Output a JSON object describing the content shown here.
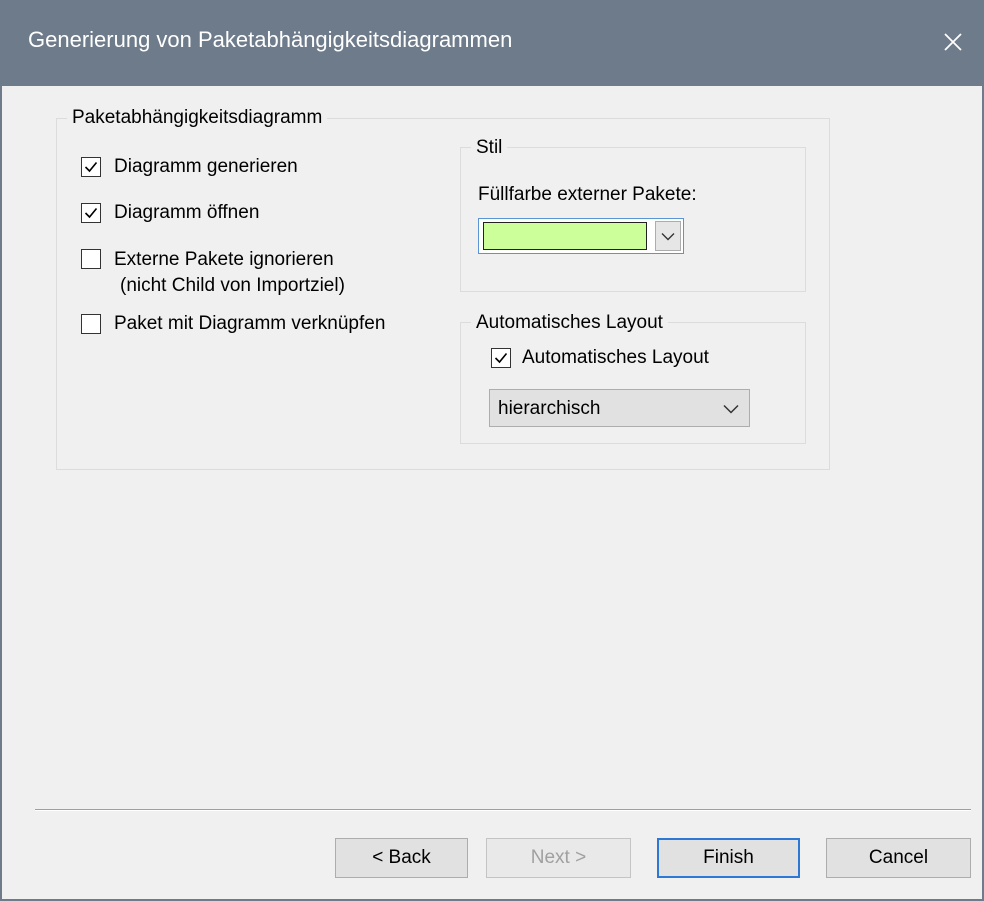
{
  "window": {
    "title": "Generierung von Paketabhängigkeitsdiagrammen"
  },
  "package_group": {
    "legend": "Paketabhängigkeitsdiagramm",
    "options": [
      {
        "label": "Diagramm generieren",
        "checked": true
      },
      {
        "label": "Diagramm öffnen",
        "checked": true
      },
      {
        "label": "Externe Pakete ignorieren",
        "label_line2": "(nicht Child von Importziel)",
        "checked": false
      },
      {
        "label": "Paket mit Diagramm verknüpfen",
        "checked": false
      }
    ]
  },
  "style_group": {
    "legend": "Stil",
    "fill_label": "Füllfarbe externer Pakete:",
    "fill_color": "#ccff99"
  },
  "layout_group": {
    "legend": "Automatisches Layout",
    "checkbox_label": "Automatisches Layout",
    "checked": true,
    "selected": "hierarchisch"
  },
  "buttons": {
    "back": "< Back",
    "next": "Next >",
    "finish": "Finish",
    "cancel": "Cancel"
  },
  "colors": {
    "titlebar": "#6d7b8b",
    "dialog_bg": "#f0f0f0",
    "focus_border": "#2d78d4"
  }
}
